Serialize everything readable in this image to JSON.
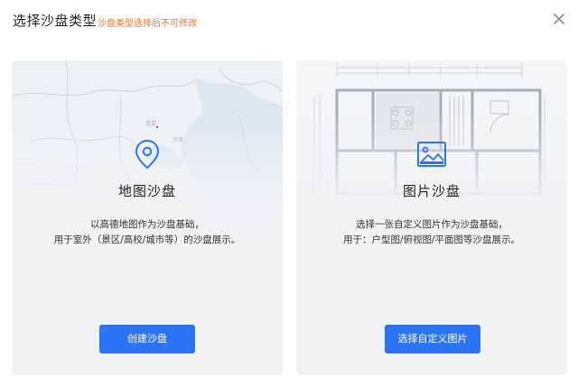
{
  "header": {
    "title": "选择沙盘类型",
    "subtitle": "沙盘类型选择后不可修改",
    "close_icon": "close-icon"
  },
  "colors": {
    "accent": "#2b74f5",
    "warning_text": "#f0722a",
    "card_bg": "#f1f2f4"
  },
  "cards": [
    {
      "icon": "location-pin-icon",
      "title": "地图沙盘",
      "desc_line1": "以高德地图作为沙盘基础，",
      "desc_line2": "用于室外（景区/高校/城市等）的沙盘展示。",
      "button_label": "创建沙盘",
      "map_labels": {
        "beijing": "北京",
        "tianjin": "天津"
      }
    },
    {
      "icon": "image-icon",
      "title": "图片沙盘",
      "desc_line1": "选择一张自定义图片作为沙盘基础，",
      "desc_line2": "用于：户型图/俯视图/平面图等沙盘展示。",
      "button_label": "选择自定义图片"
    }
  ]
}
